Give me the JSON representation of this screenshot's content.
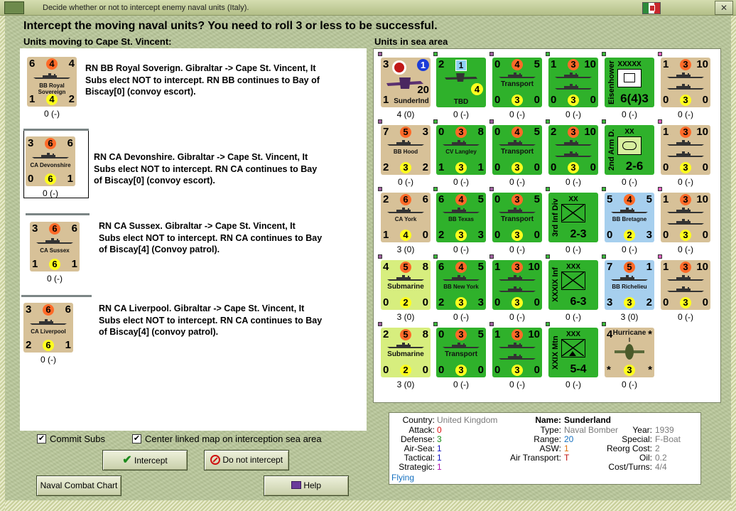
{
  "window": {
    "title": "Decide whether or not to intercept enemy naval units (Italy).",
    "close": "✕"
  },
  "heading": "Intercept the moving naval units?  You need to roll 3 or less to be successful.",
  "left_label": "Units moving to Cape St. Vincent:",
  "right_label": "Units in sea area",
  "moving": [
    {
      "counter": {
        "tl": "6",
        "tc": "4",
        "tr": "4",
        "bl": "1",
        "bc": "4",
        "br": "2",
        "name": "BB Royal Sovereign"
      },
      "below": "0 (-)",
      "text": [
        "RN BB Royal Soverign.  Gibraltar -> Cape St. Vincent, It",
        "Subs elect NOT to intercept.  RN BB continues to Bay of",
        "Biscay[0] (convoy escort)."
      ]
    },
    {
      "counter": {
        "tl": "3",
        "tc": "6",
        "tr": "6",
        "bl": "0",
        "bc": "6",
        "br": "1",
        "name": "CA Devonshire"
      },
      "below": "0 (-)",
      "text": [
        "RN CA Devonshire.   Gibraltar -> Cape St. Vincent, It",
        "Subs elect NOT to intercept.  RN CA continues to Bay",
        "of Biscay[0] (convoy escort)."
      ]
    },
    {
      "counter": {
        "tl": "3",
        "tc": "6",
        "tr": "6",
        "bl": "1",
        "bc": "6",
        "br": "1",
        "name": "CA Sussex"
      },
      "below": "0 (-)",
      "text": [
        "RN CA Sussex.   Gibraltar -> Cape St. Vincent, It",
        "Subs elect NOT to intercept.  RN CA continues to Bay",
        "of Biscay[4] (Convoy patrol)."
      ]
    },
    {
      "counter": {
        "tl": "3",
        "tc": "6",
        "tr": "6",
        "bl": "2",
        "bc": "6",
        "br": "1",
        "name": "CA Liverpool"
      },
      "below": "0 (-)",
      "text": [
        "RN CA Liverpool.   Gibraltar -> Cape St. Vincent, It",
        "Subs elect NOT to intercept.  RN CA continues to Bay",
        "of Biscay[4] (convoy patrol)."
      ]
    }
  ],
  "sea_units": [
    [
      {
        "kind": "air",
        "color": "tan",
        "tl": "3",
        "tr": "1",
        "br": "20",
        "bl": "1",
        "name": "SunderInd",
        "below": "4 (0)"
      },
      {
        "kind": "air2",
        "color": "grn",
        "tl": "2",
        "tr": "1",
        "bc": "4",
        "name": "TBD",
        "below": "0 (-)"
      },
      {
        "kind": "ship",
        "color": "grn",
        "tl": "0",
        "tc": "4",
        "tr": "5",
        "bl": "0",
        "bc": "3",
        "br": "0",
        "name": "Transport",
        "below": "0 (-)"
      },
      {
        "kind": "ship",
        "color": "grn",
        "tl": "1",
        "tc": "3",
        "tr": "10",
        "bl": "0",
        "bc": "3",
        "br": "0",
        "name": "",
        "below": "0 (-)"
      },
      {
        "kind": "hq",
        "color": "grn",
        "side": "Eisenhower",
        "top": "XXXXX",
        "val": "6(4)3",
        "below": "0 (-)"
      },
      {
        "kind": "ship",
        "color": "tan",
        "tl": "1",
        "tc": "3",
        "tr": "10",
        "bl": "0",
        "bc": "3",
        "br": "0",
        "name": "",
        "below": "0 (-)"
      }
    ],
    [
      {
        "kind": "ship",
        "color": "tan",
        "tl": "7",
        "tc": "5",
        "tr": "3",
        "bl": "2",
        "bc": "3",
        "br": "2",
        "name": "BB Hood",
        "below": "0 (-)"
      },
      {
        "kind": "ship",
        "color": "grn",
        "tl": "0",
        "tc": "3",
        "tr": "8",
        "bl": "1",
        "bc": "3",
        "br": "1",
        "name": "CV Langley",
        "below": "0 (-)"
      },
      {
        "kind": "ship",
        "color": "grn",
        "tl": "0",
        "tc": "4",
        "tr": "5",
        "bl": "0",
        "bc": "3",
        "br": "0",
        "name": "Transport",
        "below": "0 (-)"
      },
      {
        "kind": "ship",
        "color": "grn",
        "tl": "2",
        "tc": "3",
        "tr": "10",
        "bl": "0",
        "bc": "3",
        "br": "0",
        "name": "",
        "below": "0 (-)"
      },
      {
        "kind": "armor",
        "color": "grn",
        "side": "2nd Arm D.",
        "top": "XX",
        "val": "2-6",
        "below": "0 (-)"
      },
      {
        "kind": "ship",
        "color": "tan",
        "tl": "1",
        "tc": "3",
        "tr": "10",
        "bl": "0",
        "bc": "3",
        "br": "0",
        "name": "",
        "below": "0 (-)"
      }
    ],
    [
      {
        "kind": "ship",
        "color": "tan",
        "tl": "2",
        "tc": "6",
        "tr": "6",
        "bl": "1",
        "bc": "4",
        "br": "0",
        "name": "CA York",
        "below": "3 (0)"
      },
      {
        "kind": "ship",
        "color": "grn",
        "tl": "6",
        "tc": "4",
        "tr": "5",
        "bl": "2",
        "bc": "3",
        "br": "3",
        "name": "BB Texas",
        "below": "0 (-)"
      },
      {
        "kind": "ship",
        "color": "grn",
        "tl": "0",
        "tc": "3",
        "tr": "5",
        "bl": "0",
        "bc": "3",
        "br": "0",
        "name": "Transport",
        "below": "0 (-)"
      },
      {
        "kind": "inf",
        "color": "grn",
        "side": "3rd Inf Div",
        "top": "XX",
        "val": "2-3",
        "below": "0 (-)"
      },
      {
        "kind": "ship",
        "color": "lblue",
        "tl": "5",
        "tc": "4",
        "tr": "5",
        "bl": "0",
        "bc": "2",
        "br": "3",
        "name": "BB Bretagne",
        "below": "0 (-)"
      },
      {
        "kind": "ship",
        "color": "tan",
        "tl": "1",
        "tc": "3",
        "tr": "10",
        "bl": "0",
        "bc": "3",
        "br": "0",
        "name": "",
        "below": "0 (-)"
      }
    ],
    [
      {
        "kind": "ship",
        "color": "lgreen",
        "tl": "4",
        "tc": "5",
        "tr": "8",
        "bl": "0",
        "bc": "2",
        "br": "0",
        "name": "Submarine",
        "below": "3 (0)"
      },
      {
        "kind": "ship",
        "color": "grn",
        "tl": "6",
        "tc": "4",
        "tr": "5",
        "bl": "2",
        "bc": "3",
        "br": "3",
        "name": "BB New York",
        "below": "0 (-)"
      },
      {
        "kind": "ship",
        "color": "grn",
        "tl": "1",
        "tc": "3",
        "tr": "10",
        "bl": "0",
        "bc": "3",
        "br": "0",
        "name": "",
        "below": "0 (-)"
      },
      {
        "kind": "inf",
        "color": "grn",
        "side": "XXXIX Inf",
        "top": "XXX",
        "val": "6-3",
        "below": "0 (-)"
      },
      {
        "kind": "ship",
        "color": "lblue",
        "tl": "7",
        "tc": "5",
        "tr": "1",
        "bl": "3",
        "bc": "3",
        "br": "2",
        "name": "BB Richelieu",
        "below": "3 (0)"
      },
      {
        "kind": "ship",
        "color": "tan",
        "tl": "1",
        "tc": "3",
        "tr": "10",
        "bl": "0",
        "bc": "3",
        "br": "0",
        "name": "",
        "below": "0 (-)"
      }
    ],
    [
      {
        "kind": "ship",
        "color": "lgreen",
        "tl": "2",
        "tc": "5",
        "tr": "8",
        "bl": "0",
        "bc": "2",
        "br": "0",
        "name": "Submarine",
        "below": "3 (0)"
      },
      {
        "kind": "ship",
        "color": "grn",
        "tl": "0",
        "tc": "3",
        "tr": "5",
        "bl": "0",
        "bc": "3",
        "br": "0",
        "name": "Transport",
        "below": "0 (-)"
      },
      {
        "kind": "ship",
        "color": "grn",
        "tl": "1",
        "tc": "3",
        "tr": "10",
        "bl": "0",
        "bc": "3",
        "br": "0",
        "name": "",
        "below": "0 (-)"
      },
      {
        "kind": "mtn",
        "color": "grn",
        "side": "XXIX Mtn",
        "top": "XXX",
        "val": "5-4",
        "below": "0 (-)"
      },
      {
        "kind": "fighter",
        "color": "tan",
        "tl": "4",
        "tr": "*",
        "bl": "*",
        "br": "*",
        "bc": "3",
        "name": "Hurricane",
        "sub": "I",
        "below": "0 (-)"
      }
    ]
  ],
  "info": {
    "country_lbl": "Country:",
    "country": "United Kingdom",
    "attack_lbl": "Attack:",
    "attack": "0",
    "defense_lbl": "Defense:",
    "defense": "3",
    "airsea_lbl": "Air-Sea:",
    "airsea": "1",
    "tactical_lbl": "Tactical:",
    "tactical": "1",
    "strategic_lbl": "Strategic:",
    "strategic": "1",
    "flying": "Flying",
    "name_lbl": "Name:",
    "name": "Sunderland",
    "type_lbl": "Type:",
    "type": "Naval Bomber",
    "year_lbl": "Year:",
    "year": "1939",
    "range_lbl": "Range:",
    "range": "20",
    "special_lbl": "Special:",
    "special": "F-Boat",
    "asw_lbl": "ASW:",
    "asw": "1",
    "reorg_lbl": "Reorg Cost:",
    "reorg": "2",
    "airtrans_lbl": "Air Transport:",
    "airtrans": "T",
    "oil_lbl": "Oil:",
    "oil": "0.2",
    "cost_lbl": "Cost/Turns:",
    "cost": "4/4"
  },
  "controls": {
    "commit_subs": "Commit Subs",
    "center_map": "Center linked map on interception sea area",
    "commit_checked": "✔",
    "center_checked": "✔",
    "intercept": "Intercept",
    "no_intercept": "Do not intercept",
    "chart": "Naval Combat Chart",
    "help": "Help"
  },
  "colors": {
    "tan": "#d7c198",
    "green": "#2fb12b",
    "lightgreen": "#d7ee7e",
    "lightblue": "#a6cfee",
    "orange_circle": "#ff6a28",
    "yellow_circle": "#ffff1e"
  }
}
